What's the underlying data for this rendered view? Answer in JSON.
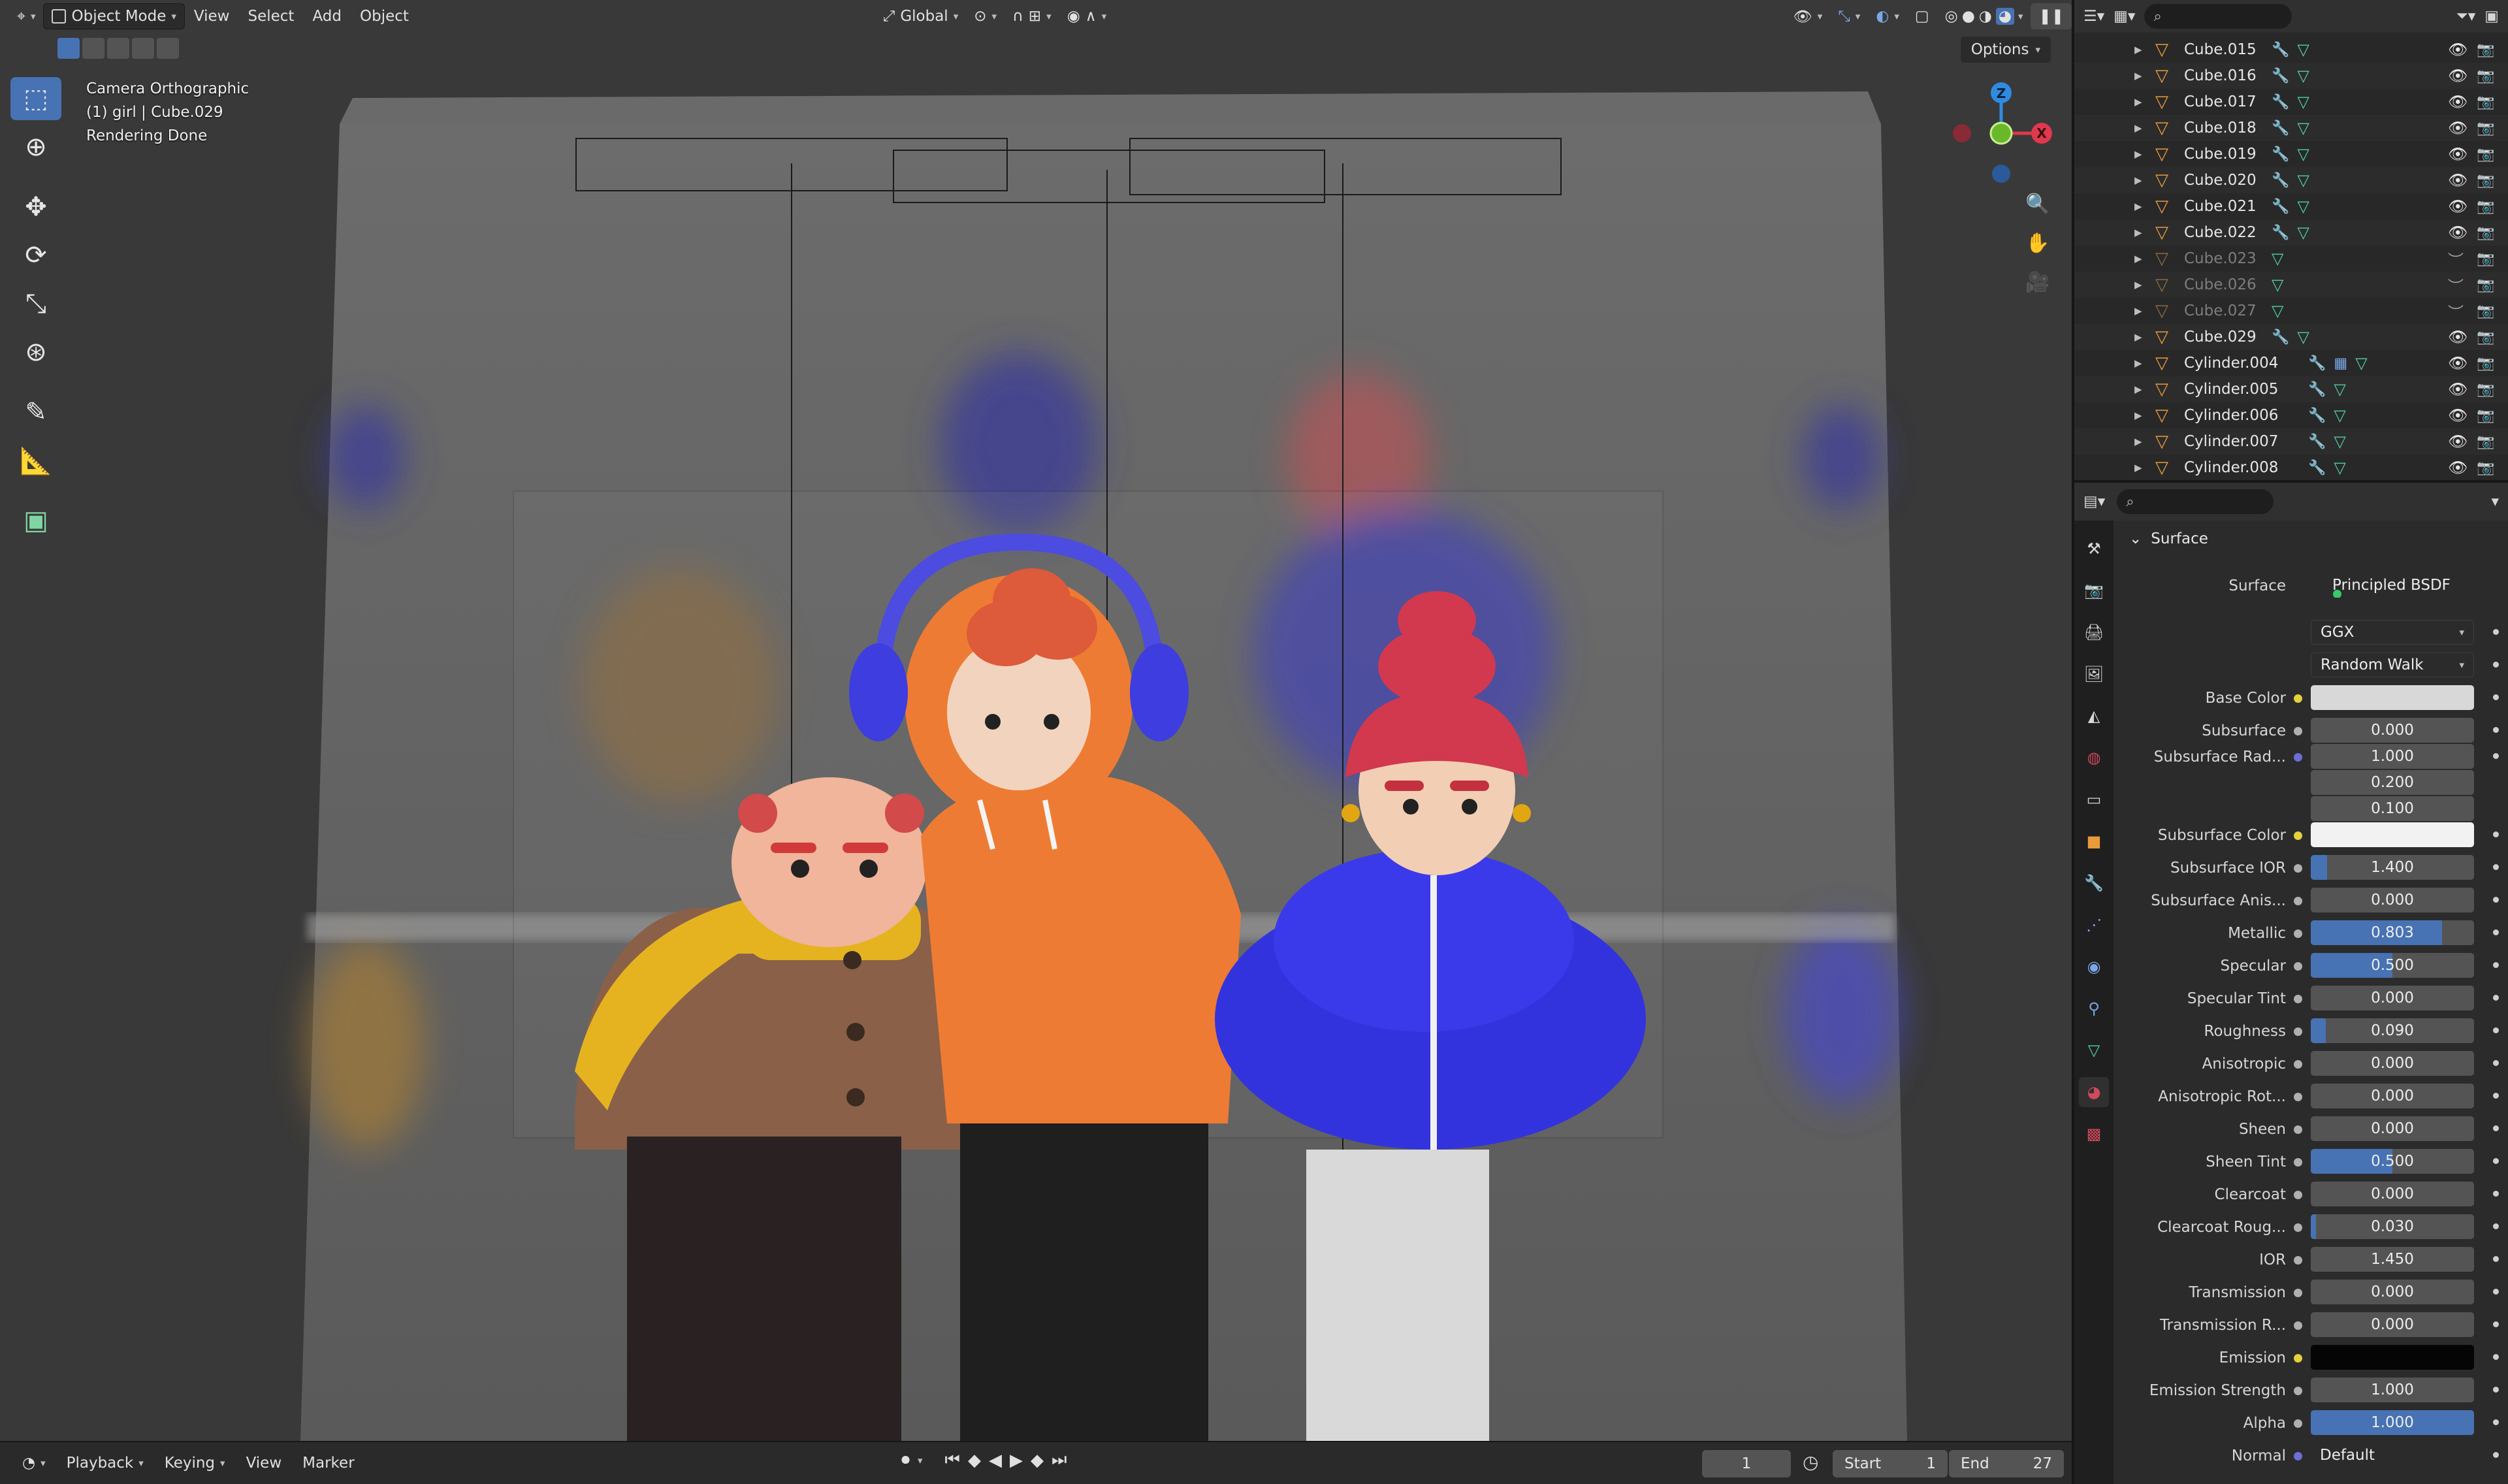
{
  "header": {
    "mode": "Object Mode",
    "menus": [
      "View",
      "Select",
      "Add",
      "Object"
    ],
    "transform_orientation": "Global"
  },
  "viewport": {
    "overlay": {
      "camera": "Camera Orthographic",
      "object": "(1) girl | Cube.029",
      "status": "Rendering Done"
    },
    "options_label": "Options",
    "gizmo": {
      "z": "Z",
      "x": "X"
    }
  },
  "timeline": {
    "menus": [
      "Playback",
      "Keying",
      "View",
      "Marker"
    ],
    "current_frame": "1",
    "start_label": "Start",
    "start": "1",
    "end_label": "End",
    "end": "27"
  },
  "outliner": {
    "search_placeholder": "",
    "rows": [
      {
        "name": "Cube.015",
        "dim": false,
        "extra": false
      },
      {
        "name": "Cube.016",
        "dim": false,
        "extra": false
      },
      {
        "name": "Cube.017",
        "dim": false,
        "extra": false
      },
      {
        "name": "Cube.018",
        "dim": false,
        "extra": false
      },
      {
        "name": "Cube.019",
        "dim": false,
        "extra": false
      },
      {
        "name": "Cube.020",
        "dim": false,
        "extra": false
      },
      {
        "name": "Cube.021",
        "dim": false,
        "extra": false
      },
      {
        "name": "Cube.022",
        "dim": false,
        "extra": false
      },
      {
        "name": "Cube.023",
        "dim": true,
        "extra": false
      },
      {
        "name": "Cube.026",
        "dim": true,
        "extra": false
      },
      {
        "name": "Cube.027",
        "dim": true,
        "extra": false
      },
      {
        "name": "Cube.029",
        "dim": false,
        "extra": false
      },
      {
        "name": "Cylinder.004",
        "dim": false,
        "extra": true
      },
      {
        "name": "Cylinder.005",
        "dim": false,
        "extra": false
      },
      {
        "name": "Cylinder.006",
        "dim": false,
        "extra": false
      },
      {
        "name": "Cylinder.007",
        "dim": false,
        "extra": false
      },
      {
        "name": "Cylinder.008",
        "dim": false,
        "extra": false
      }
    ]
  },
  "properties": {
    "panel_title": "Surface",
    "surface_label": "Surface",
    "surface_node": "Principled BSDF",
    "distribution": "GGX",
    "subsurface_method": "Random Walk",
    "rows": [
      {
        "label": "Base Color",
        "value": "",
        "kind": "color",
        "color": "#d8d8d8",
        "dot": "yellow"
      },
      {
        "label": "Subsurface",
        "value": "0.000",
        "fill": 0,
        "dot": "gray"
      },
      {
        "label": "Subsurface Rad...",
        "value": "1.000",
        "fill": 0,
        "dot": "purple"
      },
      {
        "label": "",
        "value": "0.200",
        "fill": 0,
        "dot": "none"
      },
      {
        "label": "",
        "value": "0.100",
        "fill": 0,
        "dot": "none"
      },
      {
        "label": "Subsurface Color",
        "value": "",
        "kind": "color",
        "color": "#f2f2f2",
        "dot": "yellow"
      },
      {
        "label": "Subsurface IOR",
        "value": "1.400",
        "fill": 0.1,
        "dot": "gray"
      },
      {
        "label": "Subsurface Anis...",
        "value": "0.000",
        "fill": 0,
        "dot": "gray"
      },
      {
        "label": "Metallic",
        "value": "0.803",
        "fill": 0.803,
        "dot": "gray"
      },
      {
        "label": "Specular",
        "value": "0.500",
        "fill": 0.5,
        "dot": "gray"
      },
      {
        "label": "Specular Tint",
        "value": "0.000",
        "fill": 0,
        "dot": "gray"
      },
      {
        "label": "Roughness",
        "value": "0.090",
        "fill": 0.09,
        "dot": "gray"
      },
      {
        "label": "Anisotropic",
        "value": "0.000",
        "fill": 0,
        "dot": "gray"
      },
      {
        "label": "Anisotropic Rot...",
        "value": "0.000",
        "fill": 0,
        "dot": "gray"
      },
      {
        "label": "Sheen",
        "value": "0.000",
        "fill": 0,
        "dot": "gray"
      },
      {
        "label": "Sheen Tint",
        "value": "0.500",
        "fill": 0.5,
        "dot": "gray"
      },
      {
        "label": "Clearcoat",
        "value": "0.000",
        "fill": 0,
        "dot": "gray"
      },
      {
        "label": "Clearcoat Roug...",
        "value": "0.030",
        "fill": 0.03,
        "dot": "gray"
      },
      {
        "label": "IOR",
        "value": "1.450",
        "fill": 0,
        "dot": "gray"
      },
      {
        "label": "Transmission",
        "value": "0.000",
        "fill": 0,
        "dot": "gray"
      },
      {
        "label": "Transmission R...",
        "value": "0.000",
        "fill": 0,
        "dot": "gray"
      },
      {
        "label": "Emission",
        "value": "",
        "kind": "color",
        "color": "#050505",
        "dot": "yellow"
      },
      {
        "label": "Emission Strength",
        "value": "1.000",
        "fill": 0,
        "dot": "gray"
      },
      {
        "label": "Alpha",
        "value": "1.000",
        "fill": 1.0,
        "dot": "gray"
      },
      {
        "label": "Normal",
        "value": "Default",
        "kind": "text",
        "dot": "purple"
      }
    ]
  },
  "colors": {
    "accent": "#4772b3",
    "outliner_object": "#e89a3c",
    "modifier": "#7aa7e8",
    "mesh_data": "#4fd1a0"
  }
}
